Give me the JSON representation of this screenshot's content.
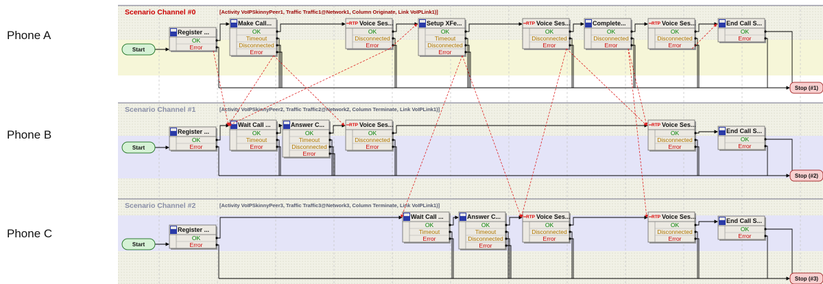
{
  "row_labels": [
    "Phone A",
    "Phone B",
    "Phone C"
  ],
  "channels": [
    {
      "title": "Scenario Channel #0",
      "info": "[Activity VoIPSkinnyPeer1, Traffic Traffic1@Network1, Column Originate, Link VoIPLink1)]",
      "title_color": "#cc0000",
      "info_color": "#990000",
      "start_label": "Start",
      "stop_label": "Stop (#1)",
      "blocks": [
        {
          "title": "Register ...",
          "icon": "hl",
          "ports": [
            {
              "label": "OK",
              "kind": "ok"
            },
            {
              "label": "Error",
              "kind": "err"
            }
          ]
        },
        {
          "title": "Make Call...",
          "icon": "hl",
          "ports": [
            {
              "label": "OK",
              "kind": "ok"
            },
            {
              "label": "Timeout",
              "kind": "warn"
            },
            {
              "label": "Disconnected",
              "kind": "warn"
            },
            {
              "label": "Error",
              "kind": "err"
            }
          ]
        },
        {
          "title": "Voice Ses...",
          "icon": "rtp",
          "ports": [
            {
              "label": "OK",
              "kind": "ok"
            },
            {
              "label": "Disconnected",
              "kind": "warn"
            },
            {
              "label": "Error",
              "kind": "err"
            }
          ]
        },
        {
          "title": "Setup XFe...",
          "icon": "hl",
          "ports": [
            {
              "label": "OK",
              "kind": "ok"
            },
            {
              "label": "Timeout",
              "kind": "warn"
            },
            {
              "label": "Disconnected",
              "kind": "warn"
            },
            {
              "label": "Error",
              "kind": "err"
            }
          ]
        },
        {
          "title": "Voice Ses...",
          "icon": "rtp",
          "ports": [
            {
              "label": "OK",
              "kind": "ok"
            },
            {
              "label": "Disconnected",
              "kind": "warn"
            },
            {
              "label": "Error",
              "kind": "err"
            }
          ]
        },
        {
          "title": "Complete...",
          "icon": "hl",
          "ports": [
            {
              "label": "OK",
              "kind": "ok"
            },
            {
              "label": "Disconnected",
              "kind": "warn"
            },
            {
              "label": "Error",
              "kind": "err"
            }
          ]
        },
        {
          "title": "Voice Ses...",
          "icon": "rtp",
          "ports": [
            {
              "label": "OK",
              "kind": "ok"
            },
            {
              "label": "Disconnected",
              "kind": "warn"
            },
            {
              "label": "Error",
              "kind": "err"
            }
          ]
        },
        {
          "title": "End Call S...",
          "icon": "hl",
          "ports": [
            {
              "label": "OK",
              "kind": "ok"
            },
            {
              "label": "Error",
              "kind": "err"
            }
          ]
        }
      ]
    },
    {
      "title": "Scenario Channel #1",
      "info": "[Activity VoIPSkinnyPeer2, Traffic Traffic2@Network2, Column Terminate, Link VoIPLink1)]",
      "title_color": "#8a8fa8",
      "info_color": "#555a70",
      "start_label": "Start",
      "stop_label": "Stop (#2)",
      "blocks": [
        {
          "title": "Register ...",
          "icon": "hl",
          "ports": [
            {
              "label": "OK",
              "kind": "ok"
            },
            {
              "label": "Error",
              "kind": "err"
            }
          ]
        },
        {
          "title": "Wait Call ...",
          "icon": "hl",
          "ports": [
            {
              "label": "OK",
              "kind": "ok"
            },
            {
              "label": "Timeout",
              "kind": "warn"
            },
            {
              "label": "Error",
              "kind": "err"
            }
          ]
        },
        {
          "title": "Answer C...",
          "icon": "hl",
          "ports": [
            {
              "label": "OK",
              "kind": "ok"
            },
            {
              "label": "Timeout",
              "kind": "warn"
            },
            {
              "label": "Disconnected",
              "kind": "warn"
            },
            {
              "label": "Error",
              "kind": "err"
            }
          ]
        },
        {
          "title": "Voice Ses...",
          "icon": "rtp",
          "ports": [
            {
              "label": "OK",
              "kind": "ok"
            },
            {
              "label": "Disconnected",
              "kind": "warn"
            },
            {
              "label": "Error",
              "kind": "err"
            }
          ]
        },
        {
          "title": "Voice Ses...",
          "icon": "rtp",
          "ports": [
            {
              "label": "OK",
              "kind": "ok"
            },
            {
              "label": "Disconnected",
              "kind": "warn"
            },
            {
              "label": "Error",
              "kind": "err"
            }
          ]
        },
        {
          "title": "End Call S...",
          "icon": "hl",
          "ports": [
            {
              "label": "OK",
              "kind": "ok"
            },
            {
              "label": "Error",
              "kind": "err"
            }
          ]
        }
      ]
    },
    {
      "title": "Scenario Channel #2",
      "info": "[Activity VoIPSkinnyPeer3, Traffic Traffic3@Network3, Column Terminate, Link VoIPLink1)]",
      "title_color": "#8a8fa8",
      "info_color": "#555a70",
      "start_label": "Start",
      "stop_label": "Stop (#3)",
      "blocks": [
        {
          "title": "Register ...",
          "icon": "hl",
          "ports": [
            {
              "label": "OK",
              "kind": "ok"
            },
            {
              "label": "Error",
              "kind": "err"
            }
          ]
        },
        {
          "title": "Wait Call ...",
          "icon": "hl",
          "ports": [
            {
              "label": "OK",
              "kind": "ok"
            },
            {
              "label": "Timeout",
              "kind": "warn"
            },
            {
              "label": "Error",
              "kind": "err"
            }
          ]
        },
        {
          "title": "Answer C...",
          "icon": "hl",
          "ports": [
            {
              "label": "OK",
              "kind": "ok"
            },
            {
              "label": "Timeout",
              "kind": "warn"
            },
            {
              "label": "Disconnected",
              "kind": "warn"
            },
            {
              "label": "Error",
              "kind": "err"
            }
          ]
        },
        {
          "title": "Voice Ses...",
          "icon": "rtp",
          "ports": [
            {
              "label": "OK",
              "kind": "ok"
            },
            {
              "label": "Disconnected",
              "kind": "warn"
            },
            {
              "label": "Error",
              "kind": "err"
            }
          ]
        },
        {
          "title": "Voice Ses...",
          "icon": "rtp",
          "ports": [
            {
              "label": "OK",
              "kind": "ok"
            },
            {
              "label": "Disconnected",
              "kind": "warn"
            },
            {
              "label": "Error",
              "kind": "err"
            }
          ]
        },
        {
          "title": "End Call S...",
          "icon": "hl",
          "ports": [
            {
              "label": "OK",
              "kind": "ok"
            },
            {
              "label": "Error",
              "kind": "err"
            }
          ]
        }
      ]
    }
  ],
  "colors": {
    "ok": "#008000",
    "warn": "#b07800",
    "err": "#cc0000",
    "start_fill": "#d6f2d6",
    "start_stroke": "#2e7d32",
    "stop_fill": "#f8d0d0",
    "stop_stroke": "#a33",
    "signal": "#dd2222",
    "lane_yellow": "#f6f6d8",
    "lane_blue": "#e4e4f8",
    "lane_grey": "#ececdc"
  }
}
